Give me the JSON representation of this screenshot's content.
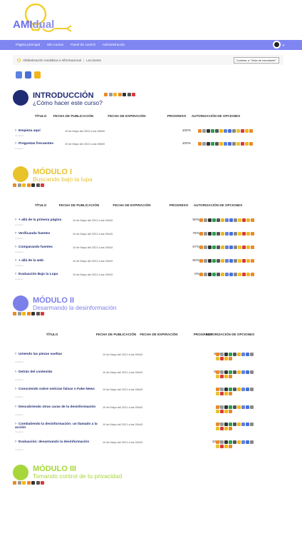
{
  "brand": {
    "name_a": "AMI",
    "name_b": "dual"
  },
  "nav": [
    "Página principal",
    "Mis cursos",
    "Panel de control",
    "Administración"
  ],
  "breadcrumb": {
    "course": "Alfabetización mediática e informacional",
    "section": "Lecciones",
    "student_view": "Cambiar a \"Vista de estudiante\""
  },
  "columns": {
    "title": "TÍTULO",
    "pub": "FECHA DE PUBLICACIÓN",
    "exp": "FECHA DE EXPIRACIÓN",
    "progress": "PROGRESO",
    "auth": "AUTORIZACIÓN DE OPCIONES"
  },
  "sections": [
    {
      "title": "INTRODUCCIÓN",
      "subtitle": "¿Cómo hacer este curso?",
      "color": "#1f2b73",
      "rows": [
        {
          "title": "Empieza aquí",
          "sub": "Creando",
          "date": "19 de Mayo del 2022 a las 08h00",
          "pct": "100%"
        },
        {
          "title": "Preguntas frecuentes",
          "sub": "Creando",
          "date": "19 de Mayo del 2022 a las 08h00",
          "pct": "100%"
        }
      ]
    },
    {
      "title": "MÓDULO I",
      "subtitle": "Buscando bajo la lupa",
      "color": "#e8c32b",
      "rows": [
        {
          "title": "+ allá de la primera página",
          "sub": "Creando",
          "date": "10 de Mayo del 2021 a las 00h43",
          "pct": "50%"
        },
        {
          "title": "Verificando fuentes",
          "sub": "Creando",
          "date": "10 de Mayo del 2021 a las 00h43",
          "pct": "75%"
        },
        {
          "title": "Comparando fuentes",
          "sub": "Creando",
          "date": "10 de Mayo del 2021 a las 00h43",
          "pct": "67%"
        },
        {
          "title": "+ allá de la web",
          "sub": "Creando",
          "date": "10 de Mayo del 2021 a las 00h43",
          "pct": "60%"
        },
        {
          "title": "Evaluación Bajo la Lupa",
          "sub": "Creando",
          "date": "10 de Mayo del 2021 a las 00h43",
          "pct": "0%"
        }
      ]
    },
    {
      "title": "MÓDULO II",
      "subtitle": "Desarmando la desinformación",
      "color": "#7b7fe8",
      "rows": [
        {
          "title": "Uniendo las piezas sueltas",
          "sub": "Creando",
          "date": "10 de Mayo del 2021 a las 00h43",
          "pct": "60%"
        },
        {
          "title": "Detrás del contenido",
          "sub": "Creando",
          "date": "10 de Mayo del 2021 a las 00h43",
          "pct": "67%"
        },
        {
          "title": "Conociendo sobre noticias falsas o Fake News",
          "sub": "Creando",
          "date": "10 de Mayo del 2021 a las 00h43",
          "pct": "0%"
        },
        {
          "title": "Descubriendo otras caras de la desinformación",
          "sub": "Creando",
          "date": "10 de Mayo del 2021 a las 00h43",
          "pct": "0%"
        },
        {
          "title": "Combatiendo la desinformación: un llamado a la acción",
          "sub": "Creando",
          "date": "10 de Mayo del 2021 a las 00h43",
          "pct": "0%"
        },
        {
          "title": "Evaluación: desarmando la desinformación",
          "sub": "Creando",
          "date": "10 de Mayo del 2021 a las 00h43",
          "pct": "100%"
        }
      ]
    },
    {
      "title": "MÓDULO III",
      "subtitle": "Tomando control de tu privacidad",
      "color": "#a6d63a",
      "rows": []
    }
  ]
}
